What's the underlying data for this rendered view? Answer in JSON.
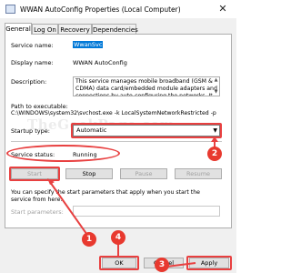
{
  "window": {
    "title": "WWAN AutoConfig Properties (Local Computer)",
    "close_glyph": "✕"
  },
  "tabs": [
    "General",
    "Log On",
    "Recovery",
    "Dependencies"
  ],
  "fields": {
    "service_name_label": "Service name:",
    "service_name_value": "WwanSvc",
    "display_name_label": "Display name:",
    "display_name_value": "WWAN AutoConfig",
    "description_label": "Description:",
    "description_value": "This service manages mobile broadband (GSM & CDMA) data card/embedded module adapters and connections by auto-configuring the networks. It is",
    "path_label": "Path to executable:",
    "path_value": "C:\\WINDOWS\\system32\\svchost.exe -k LocalSystemNetworkRestricted -p",
    "startup_type_label": "Startup type:",
    "startup_type_value": "Automatic",
    "service_status_label": "Service status:",
    "service_status_value": "Running"
  },
  "buttons": {
    "start": "Start",
    "stop": "Stop",
    "pause": "Pause",
    "resume": "Resume",
    "ok": "OK",
    "cancel": "Cancel",
    "apply": "Apply"
  },
  "help_text": "You can specify the start parameters that apply when you start the service from here.",
  "start_params_label": "Start parameters:",
  "watermark": "TheGeekPage.com",
  "badges": [
    "1",
    "2",
    "3",
    "4"
  ],
  "colors": {
    "highlight": "#e84040",
    "selection": "#0078d7"
  }
}
